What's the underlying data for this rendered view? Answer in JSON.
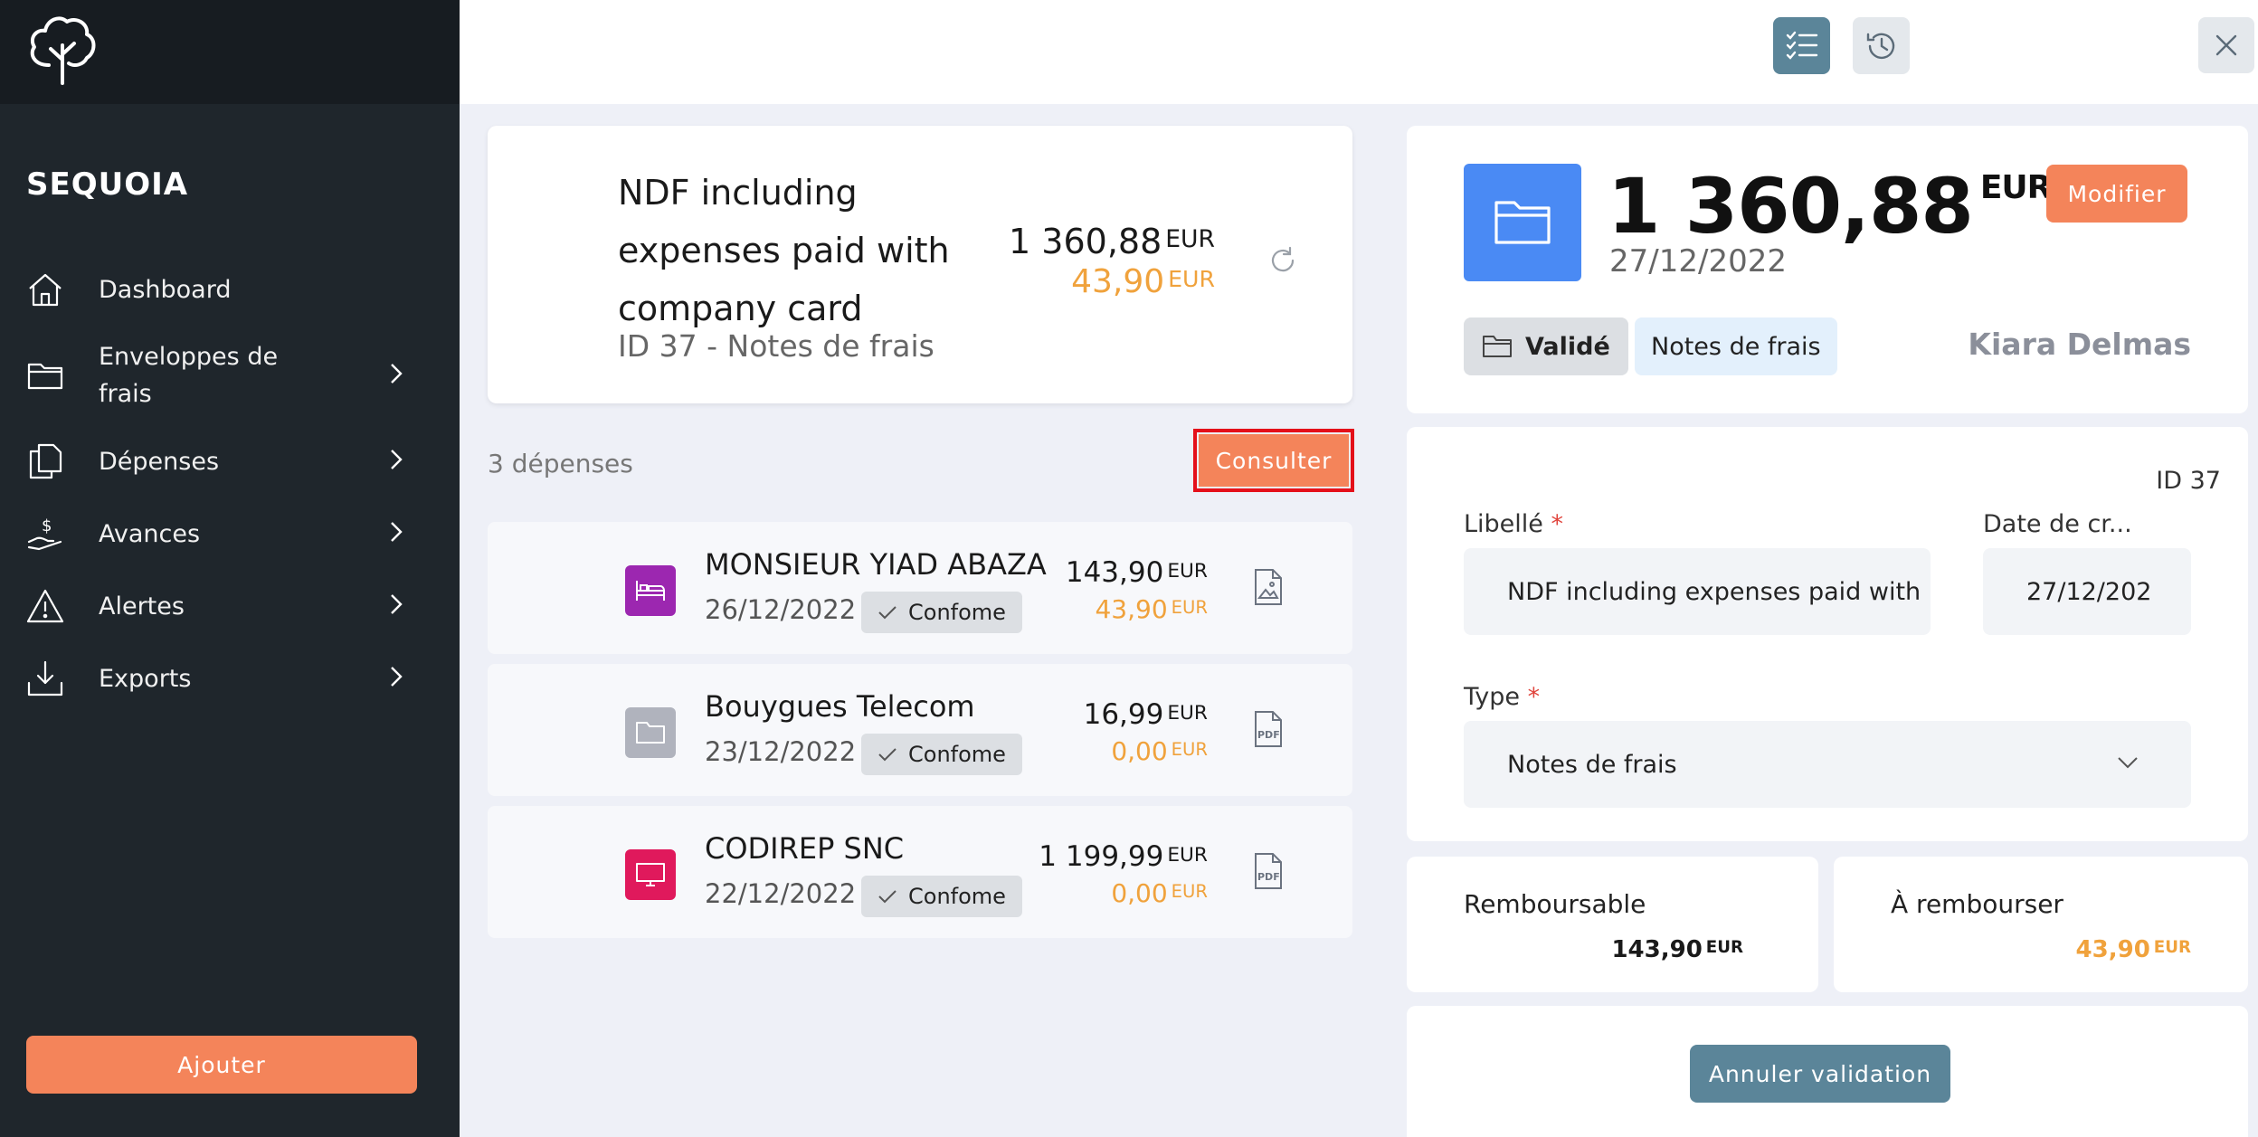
{
  "sidebar": {
    "brand": "SEQUOIA",
    "items": [
      {
        "label": "Dashboard"
      },
      {
        "label": "Enveloppes de frais"
      },
      {
        "label": "Dépenses"
      },
      {
        "label": "Avances"
      },
      {
        "label": "Alertes"
      },
      {
        "label": "Exports"
      }
    ],
    "add_label": "Ajouter"
  },
  "summary": {
    "title": "NDF including expenses paid with company card",
    "subtitle": "ID 37 - Notes de frais",
    "amount": "1 360,88",
    "amount_currency": "EUR",
    "refund_amount": "43,90",
    "refund_currency": "EUR"
  },
  "expenses_header": {
    "count": "3 dépenses",
    "consult_label": "Consulter"
  },
  "expenses": [
    {
      "name": "MONSIEUR YIAD ABAZA",
      "date": "26/12/2022",
      "status": "Confome",
      "amount": "143,90",
      "refund": "43,90",
      "currency": "EUR",
      "category_icon": "bed-icon",
      "category_color": "#9c27b0",
      "doc_icon": "image-doc-icon"
    },
    {
      "name": "Bouygues Telecom",
      "date": "23/12/2022",
      "status": "Confome",
      "amount": "16,99",
      "refund": "0,00",
      "currency": "EUR",
      "category_icon": "folder-icon",
      "category_color": "#b0b3bd",
      "doc_icon": "pdf-doc-icon"
    },
    {
      "name": "CODIREP SNC",
      "date": "22/12/2022",
      "status": "Confome",
      "amount": "1 199,99",
      "refund": "0,00",
      "currency": "EUR",
      "category_icon": "monitor-icon",
      "category_color": "#e0195c",
      "doc_icon": "pdf-doc-icon"
    }
  ],
  "detail": {
    "amount": "1 360,88",
    "currency": "EUR",
    "date": "27/12/2022",
    "modify_label": "Modifier",
    "status": "Validé",
    "type_chip": "Notes de frais",
    "owner": "Kiara Delmas",
    "form": {
      "id": "ID 37",
      "libelle_label": "Libellé",
      "libelle_value": "NDF including expenses paid with",
      "date_label": "Date de cr...",
      "date_value": "27/12/202",
      "type_label": "Type",
      "type_value": "Notes de frais",
      "required_mark": "*"
    },
    "remboursable_label": "Remboursable",
    "remboursable_value": "143,90",
    "a_rembourser_label": "À rembourser",
    "a_rembourser_value": "43,90",
    "cancel_validation_label": "Annuler validation"
  },
  "colors": {
    "accent": "#f4845a",
    "sidebar": "#1f262c",
    "teal": "#5b8599",
    "refund": "#f0a23c",
    "folder_tile": "#4a8af4"
  }
}
